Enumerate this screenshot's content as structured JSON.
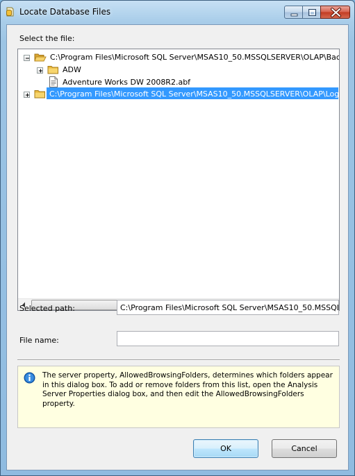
{
  "window": {
    "title": "Locate Database Files"
  },
  "labels": {
    "select_file": "Select the file:",
    "selected_path": "Selected path:",
    "file_name": "File name:"
  },
  "tree": {
    "items": [
      {
        "label": "C:\\Program Files\\Microsoft SQL Server\\MSAS10_50.MSSQLSERVER\\OLAP\\Backup",
        "icon": "folder-open-icon",
        "expanded": true
      },
      {
        "label": "ADW",
        "icon": "folder-icon",
        "expanded": false
      },
      {
        "label": "Adventure Works DW 2008R2.abf",
        "icon": "file-icon"
      },
      {
        "label": "C:\\Program Files\\Microsoft SQL Server\\MSAS10_50.MSSQLSERVER\\OLAP\\Log data",
        "icon": "folder-icon",
        "expanded": false,
        "selected": true
      }
    ],
    "scroll_grip": "III"
  },
  "fields": {
    "selected_path_value": "C:\\Program Files\\Microsoft SQL Server\\MSAS10_50.MSSQLSERVER\\OLAP\\Log data",
    "file_name_value": ""
  },
  "info": {
    "icon": "info-icon",
    "text": "The server property, AllowedBrowsingFolders, determines which folders appear in this dialog box. To add or remove folders from this list, open the Analysis Server Properties dialog box, and then edit the AllowedBrowsingFolders property."
  },
  "buttons": {
    "ok": "OK",
    "cancel": "Cancel"
  },
  "colors": {
    "selection": "#3399ff",
    "info_background": "#ffffe1",
    "close_button": "#c23b22"
  }
}
